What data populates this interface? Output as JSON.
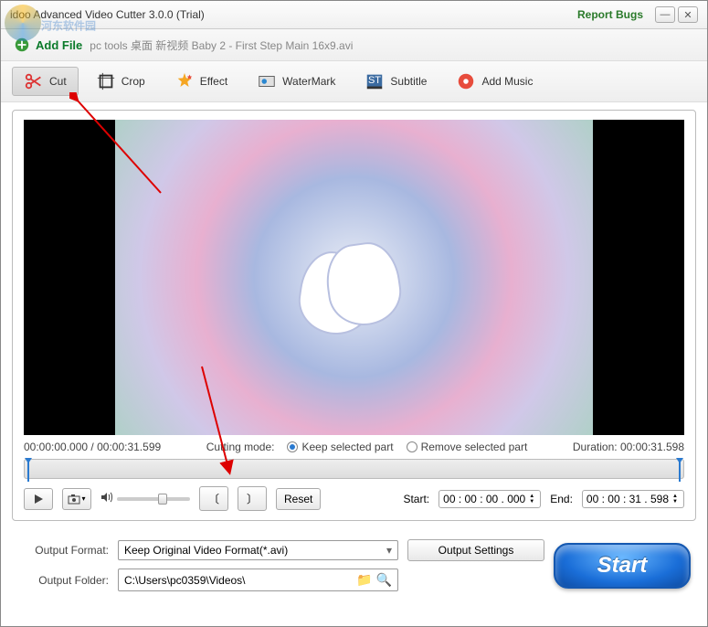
{
  "title": "idoo Advanced Video Cutter 3.0.0 (Trial)",
  "report_bugs": "Report Bugs",
  "watermark_text": "河东软件园",
  "add_file": {
    "label": "Add File",
    "path": "  pc tools 桌面 新视频 Baby 2 - First Step Main 16x9.avi"
  },
  "tools": {
    "cut": "Cut",
    "crop": "Crop",
    "effect": "Effect",
    "watermark": "WaterMark",
    "subtitle": "Subtitle",
    "addmusic": "Add Music"
  },
  "time": {
    "current": "00:00:00.000",
    "total": "00:00:31.599",
    "cutting_mode_label": "Cutting mode:",
    "keep": "Keep selected part",
    "remove": "Remove selected part",
    "duration_label": "Duration:",
    "duration": "00:00:31.598"
  },
  "controls": {
    "reset": "Reset",
    "start_label": "Start:",
    "start_value": "00 : 00 : 00 . 000",
    "end_label": "End:",
    "end_value": "00 : 00 : 31 . 598"
  },
  "output": {
    "format_label": "Output Format:",
    "format_value": "Keep Original Video Format(*.avi)",
    "settings_btn": "Output Settings",
    "folder_label": "Output Folder:",
    "folder_value": "C:\\Users\\pc0359\\Videos\\",
    "start_btn": "Start"
  }
}
